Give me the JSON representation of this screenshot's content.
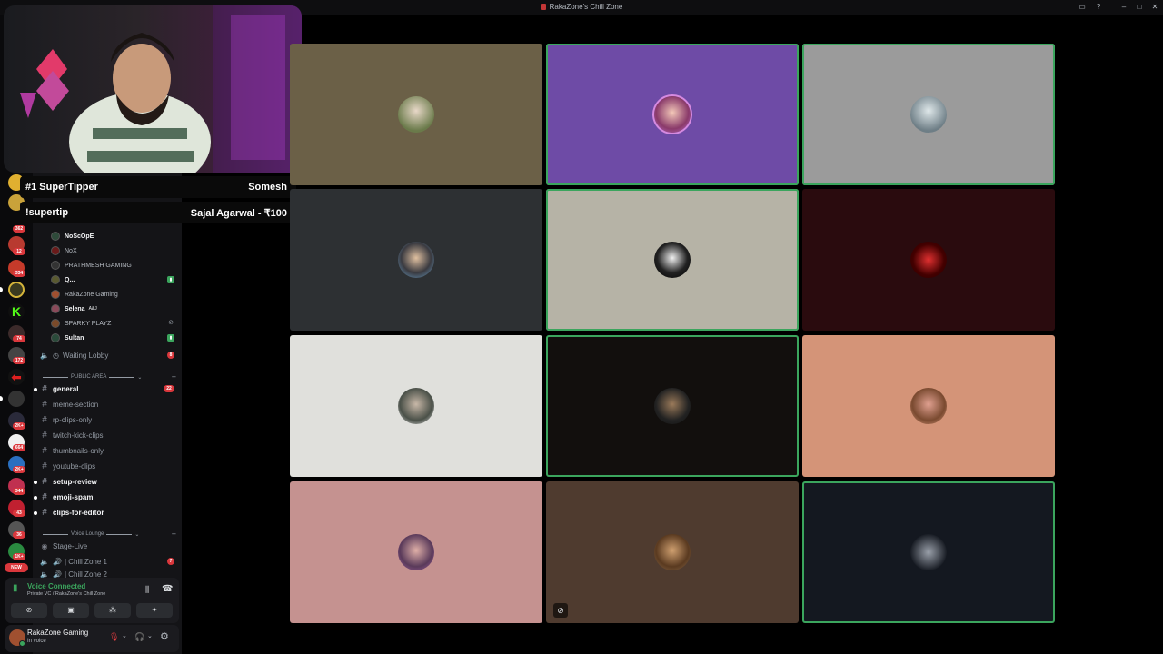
{
  "window": {
    "title": "RakaZone's Chill Zone"
  },
  "rail": {
    "badges": [
      "362",
      "12",
      "334",
      "74",
      "172",
      "2K+",
      "664",
      "2K+",
      "344",
      "43",
      "36",
      "1K+"
    ],
    "new_label": "NEW"
  },
  "sidebar": {
    "voice_users": [
      {
        "name": "NoScOpE",
        "bold": true
      },
      {
        "name": "NoX",
        "bold": false
      },
      {
        "name": "PRATHMESH GAMING",
        "bold": false
      },
      {
        "name": "Q...",
        "bold": true
      },
      {
        "name": "RakaZone Gaming",
        "bold": false
      },
      {
        "name": "Selena",
        "bold": true,
        "tag": "A&J"
      },
      {
        "name": "SPARKY PLAYZ",
        "bold": false
      },
      {
        "name": "Sultan",
        "bold": true
      }
    ],
    "waiting_lobby": {
      "label": "Waiting Lobby",
      "count": "8"
    },
    "public_area_label": "PUBLIC AREA",
    "channels": [
      {
        "name": "general",
        "unread": true,
        "badge": "22"
      },
      {
        "name": "meme-section",
        "unread": false
      },
      {
        "name": "rp-clips-only",
        "unread": false
      },
      {
        "name": "twitch-kick-clips",
        "unread": false
      },
      {
        "name": "thumbnails-only",
        "unread": false
      },
      {
        "name": "youtube-clips",
        "unread": false
      },
      {
        "name": "setup-review",
        "unread": true
      },
      {
        "name": "emoji-spam",
        "unread": true
      },
      {
        "name": "clips-for-editor",
        "unread": true
      }
    ],
    "voice_lounge_label": "Voice Lounge",
    "voice_channels": [
      {
        "name": "Stage-Live"
      },
      {
        "name": "| Chill Zone 1",
        "count": "7"
      },
      {
        "name": "| Chill Zone 2",
        "count": "9"
      }
    ]
  },
  "voice_panel": {
    "status": "Voice Connected",
    "location": "Private VC / RakaZone's Chill Zone"
  },
  "user_panel": {
    "name": "RakaZone Gaming",
    "status": "In voice"
  },
  "overlay": {
    "top_tipper_label": "#1 SuperTipper",
    "top_tipper_name": "Somesh",
    "supertip_label": "!supertip",
    "supertip_value": "Sajal Agarwal - ₹100"
  },
  "tiles": [
    {
      "bg": "#6b6047",
      "speaking": false
    },
    {
      "bg": "#6e4ba6",
      "speaking": true
    },
    {
      "bg": "#9b9b9b",
      "speaking": true
    },
    {
      "bg": "#2d3033",
      "speaking": false
    },
    {
      "bg": "#b6b3a6",
      "speaking": true
    },
    {
      "bg": "#2a0b0e",
      "speaking": false
    },
    {
      "bg": "#e0e0dc",
      "speaking": false
    },
    {
      "bg": "#120f0d",
      "speaking": true
    },
    {
      "bg": "#d49478",
      "speaking": false
    },
    {
      "bg": "#c59290",
      "speaking": false
    },
    {
      "bg": "#4f3b2f",
      "speaking": false,
      "muted": true
    },
    {
      "bg": "#141820",
      "speaking": true
    }
  ],
  "colors": {
    "accent_green": "#3ba55d",
    "badge_red": "#da373c"
  }
}
